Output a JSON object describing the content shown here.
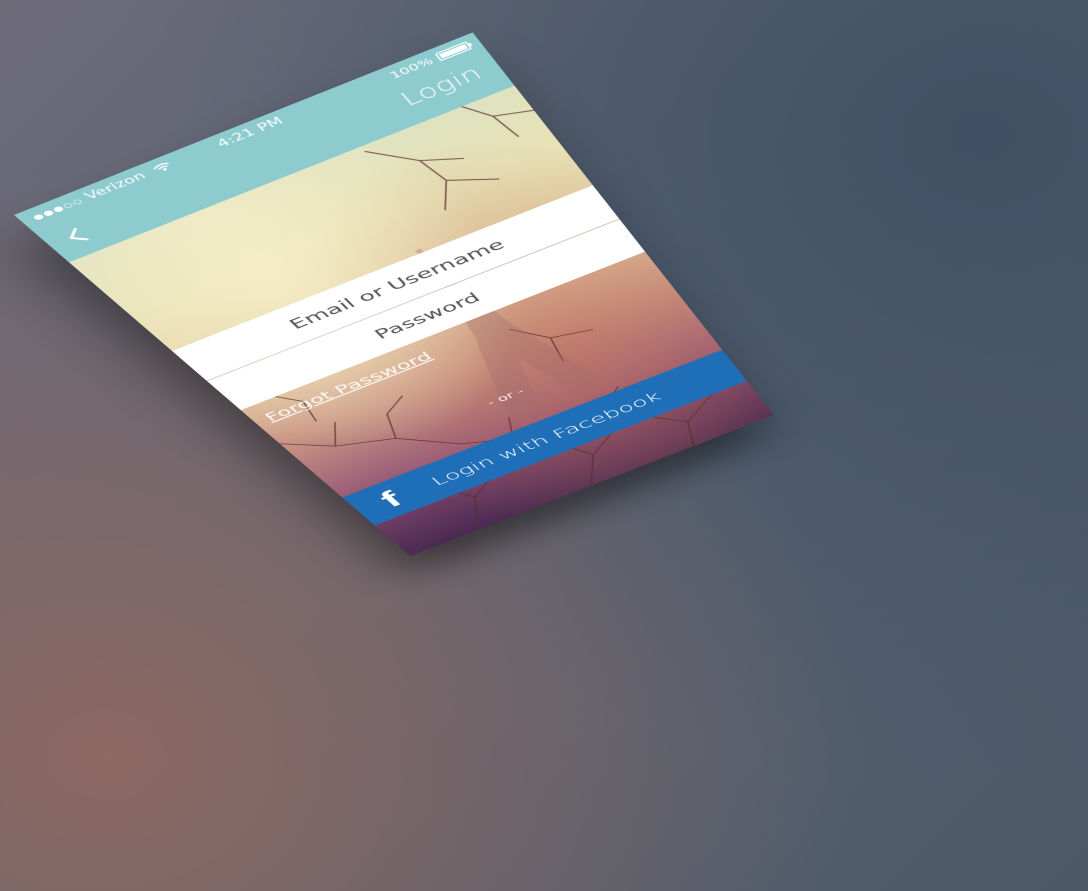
{
  "status_bar": {
    "carrier": "Verizon",
    "signal_icon": "signal-dots",
    "wifi_icon": "wifi-icon",
    "time": "4:21 PM",
    "battery_percent": "100%",
    "battery_level": 1.0
  },
  "nav": {
    "title": "Login",
    "back_icon": "chevron-left-icon"
  },
  "form": {
    "email_placeholder": "Email or Username",
    "email_value": "",
    "password_placeholder": "Password",
    "password_value": "",
    "forgot_password": "Forgot Password",
    "separator": "- or -"
  },
  "facebook": {
    "icon": "facebook-icon",
    "icon_glyph": "f",
    "label": "Login with Facebook"
  },
  "colors": {
    "topbar": "#8ecbcf",
    "facebook_blue": "#1e6fb8",
    "field_bg": "#ffffff"
  }
}
